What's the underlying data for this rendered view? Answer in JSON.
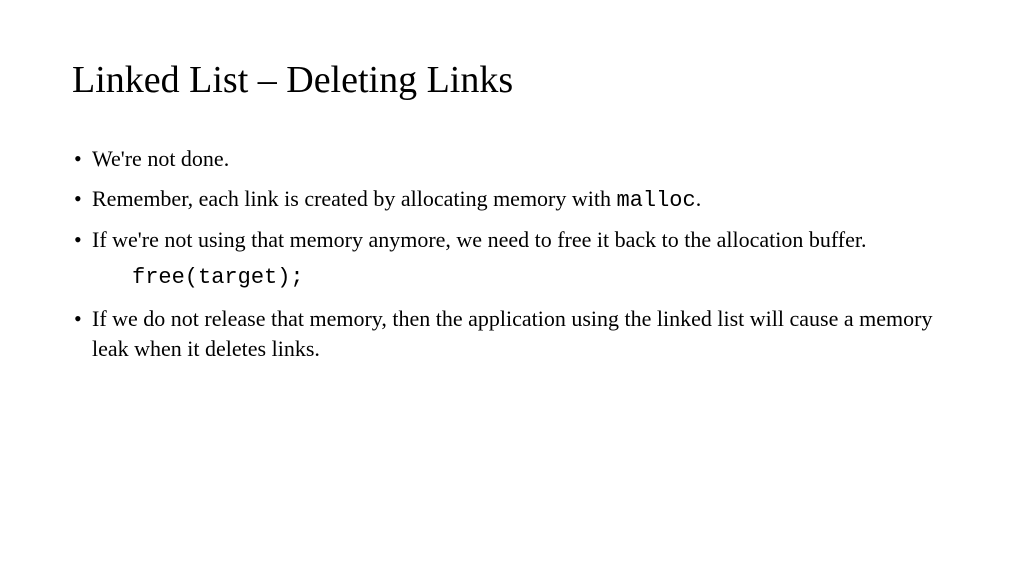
{
  "title": "Linked List – Deleting Links",
  "bullets": {
    "b1": "We're not done.",
    "b2_a": "Remember, each link is created by allocating memory with ",
    "b2_code": "malloc",
    "b2_b": ".",
    "b3": "If we're not using that memory anymore, we need to free it back to the allocation buffer.",
    "code": "free(target);",
    "b4": "If we do not release that memory, then the application using the linked list will cause a memory leak when it deletes links."
  }
}
